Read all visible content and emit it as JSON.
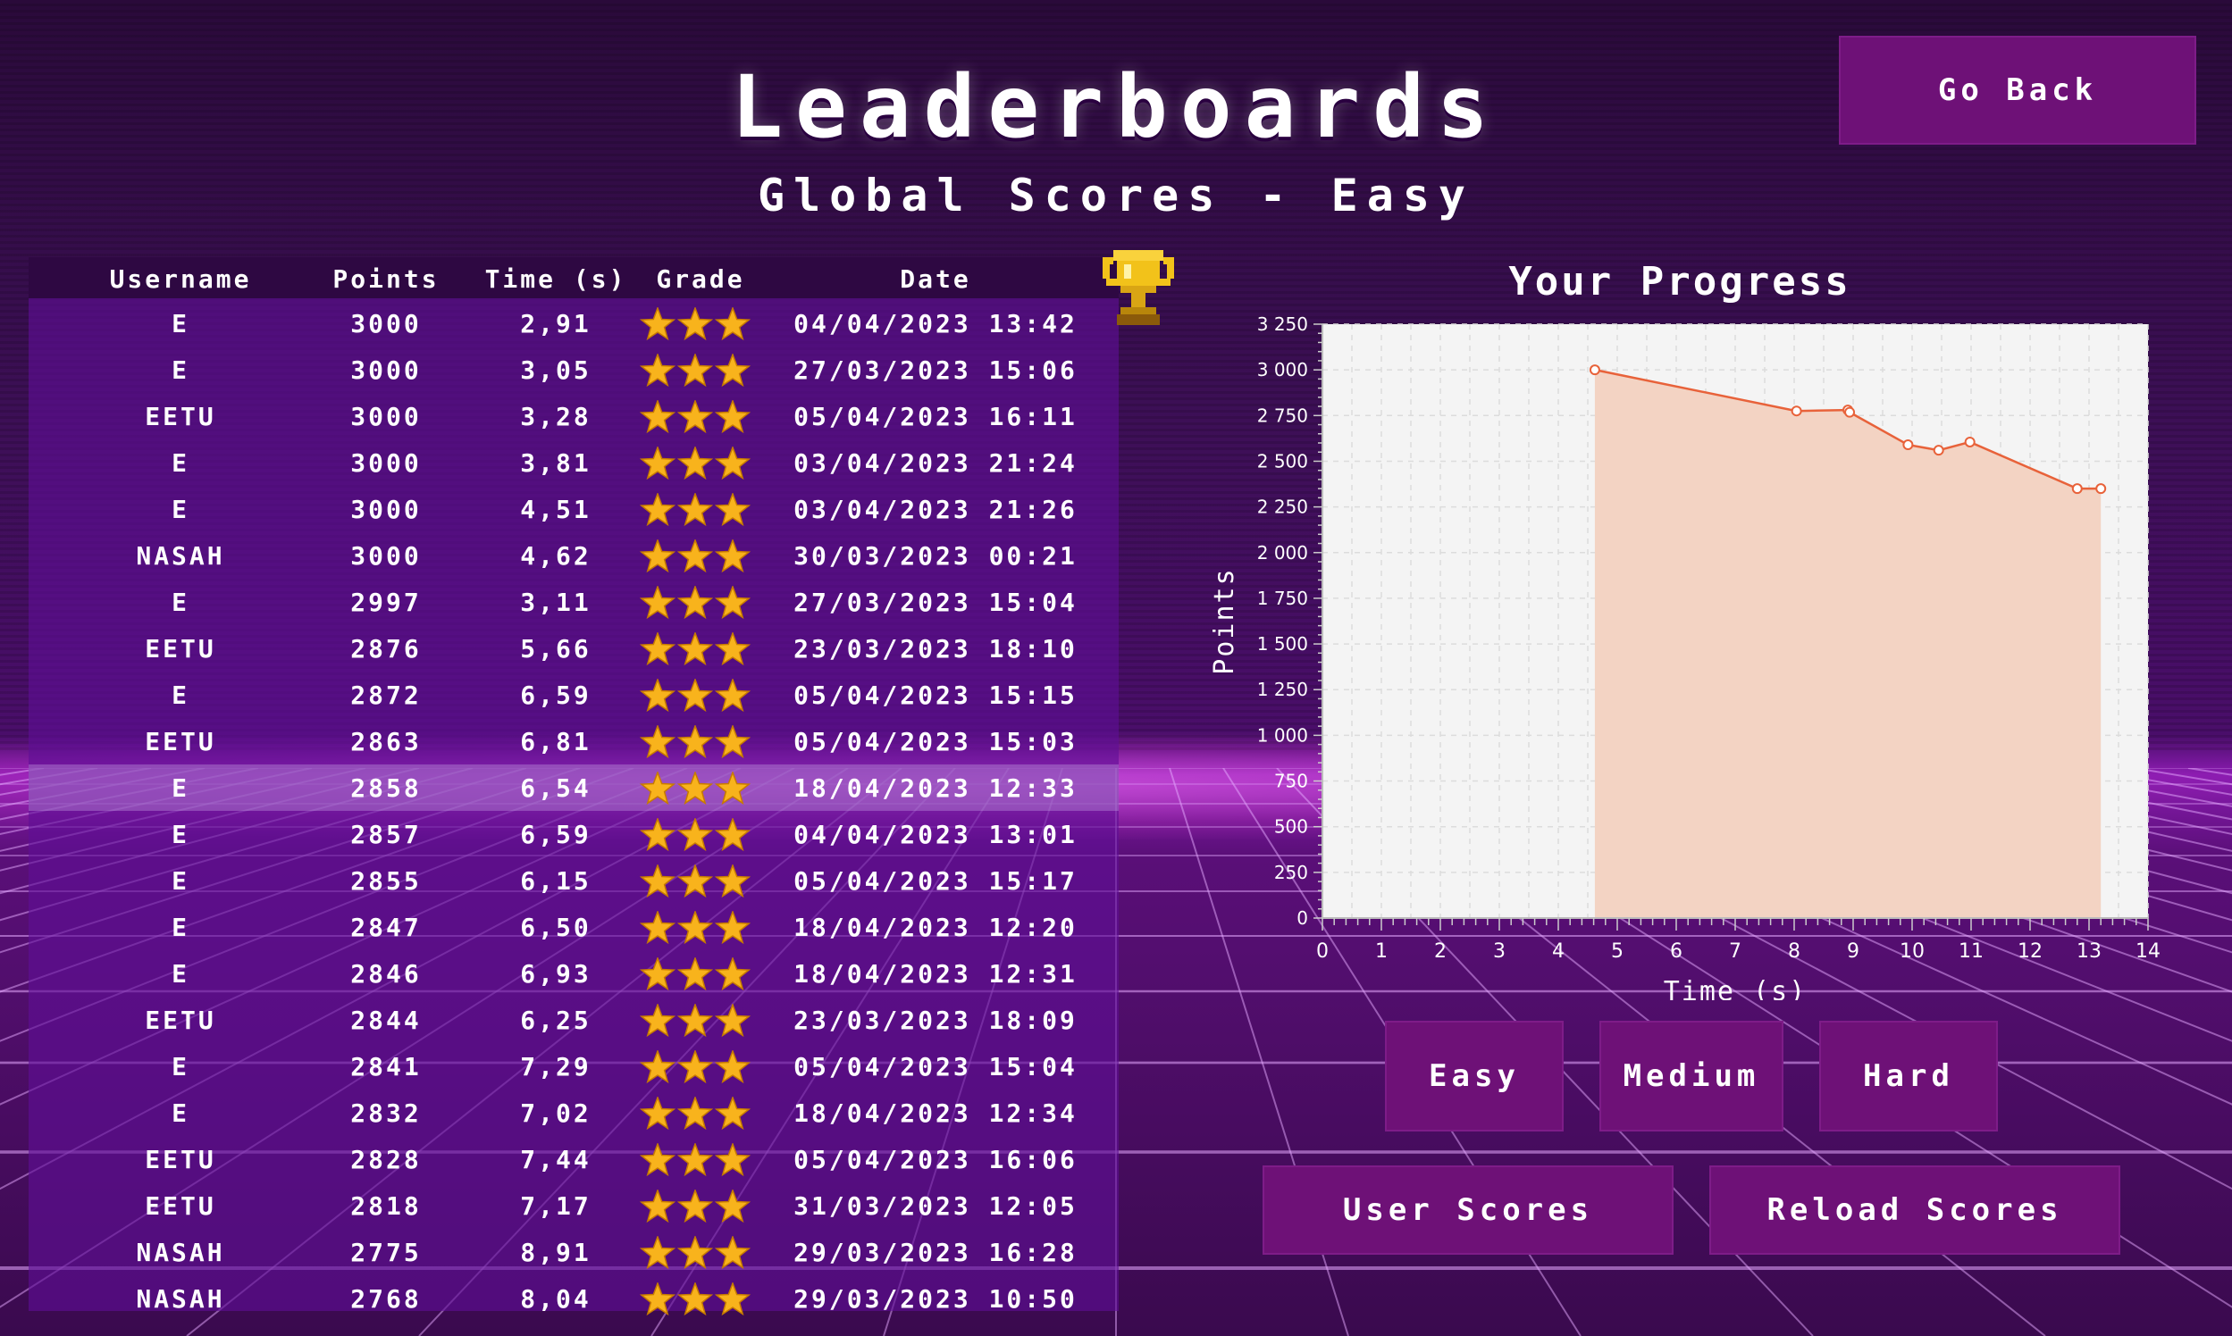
{
  "title": "Leaderboards",
  "subtitle": "Global Scores - Easy",
  "go_back_label": "Go Back",
  "table": {
    "headers": [
      "Username",
      "Points",
      "Time (s)",
      "Grade",
      "Date"
    ],
    "rows": [
      {
        "user": "E",
        "points": "3000",
        "time": "2,91",
        "stars": 3,
        "date": "04/04/2023 13:42"
      },
      {
        "user": "E",
        "points": "3000",
        "time": "3,05",
        "stars": 3,
        "date": "27/03/2023 15:06"
      },
      {
        "user": "EETU",
        "points": "3000",
        "time": "3,28",
        "stars": 3,
        "date": "05/04/2023 16:11"
      },
      {
        "user": "E",
        "points": "3000",
        "time": "3,81",
        "stars": 3,
        "date": "03/04/2023 21:24"
      },
      {
        "user": "E",
        "points": "3000",
        "time": "4,51",
        "stars": 3,
        "date": "03/04/2023 21:26"
      },
      {
        "user": "NASAH",
        "points": "3000",
        "time": "4,62",
        "stars": 3,
        "date": "30/03/2023 00:21"
      },
      {
        "user": "E",
        "points": "2997",
        "time": "3,11",
        "stars": 3,
        "date": "27/03/2023 15:04"
      },
      {
        "user": "EETU",
        "points": "2876",
        "time": "5,66",
        "stars": 3,
        "date": "23/03/2023 18:10"
      },
      {
        "user": "E",
        "points": "2872",
        "time": "6,59",
        "stars": 3,
        "date": "05/04/2023 15:15"
      },
      {
        "user": "EETU",
        "points": "2863",
        "time": "6,81",
        "stars": 3,
        "date": "05/04/2023 15:03"
      },
      {
        "user": "E",
        "points": "2858",
        "time": "6,54",
        "stars": 3,
        "date": "18/04/2023 12:33"
      },
      {
        "user": "E",
        "points": "2857",
        "time": "6,59",
        "stars": 3,
        "date": "04/04/2023 13:01"
      },
      {
        "user": "E",
        "points": "2855",
        "time": "6,15",
        "stars": 3,
        "date": "05/04/2023 15:17"
      },
      {
        "user": "E",
        "points": "2847",
        "time": "6,50",
        "stars": 3,
        "date": "18/04/2023 12:20"
      },
      {
        "user": "E",
        "points": "2846",
        "time": "6,93",
        "stars": 3,
        "date": "18/04/2023 12:31"
      },
      {
        "user": "EETU",
        "points": "2844",
        "time": "6,25",
        "stars": 3,
        "date": "23/03/2023 18:09"
      },
      {
        "user": "E",
        "points": "2841",
        "time": "7,29",
        "stars": 3,
        "date": "05/04/2023 15:04"
      },
      {
        "user": "E",
        "points": "2832",
        "time": "7,02",
        "stars": 3,
        "date": "18/04/2023 12:34"
      },
      {
        "user": "EETU",
        "points": "2828",
        "time": "7,44",
        "stars": 3,
        "date": "05/04/2023 16:06"
      },
      {
        "user": "EETU",
        "points": "2818",
        "time": "7,17",
        "stars": 3,
        "date": "31/03/2023 12:05"
      },
      {
        "user": "NASAH",
        "points": "2775",
        "time": "8,91",
        "stars": 3,
        "date": "29/03/2023 16:28"
      },
      {
        "user": "NASAH",
        "points": "2768",
        "time": "8,04",
        "stars": 3,
        "date": "29/03/2023 10:50"
      }
    ]
  },
  "chart_data": {
    "type": "area",
    "title": "Your Progress",
    "xlabel": "Time (s)",
    "ylabel": "Points",
    "xlim": [
      0,
      14
    ],
    "ylim": [
      0,
      3250
    ],
    "x_ticks": [
      0,
      1,
      2,
      3,
      4,
      5,
      6,
      7,
      8,
      9,
      10,
      11,
      12,
      13,
      14
    ],
    "y_ticks": [
      0,
      250,
      500,
      750,
      1000,
      1250,
      1500,
      1750,
      2000,
      2250,
      2500,
      2750,
      3000,
      3250
    ],
    "y_tick_labels": [
      "0",
      "250",
      "500",
      "750",
      "1 000",
      "1 250",
      "1 500",
      "1 750",
      "2 000",
      "2 250",
      "2 500",
      "2 750",
      "3 000",
      "3 250"
    ],
    "grid": true,
    "series": [
      {
        "x": [
          4.62,
          8.04,
          8.91,
          8.94,
          9.93,
          10.45,
          10.98,
          12.8,
          13.2
        ],
        "y": [
          3000,
          2775,
          2780,
          2768,
          2590,
          2560,
          2605,
          2350,
          2350
        ]
      }
    ]
  },
  "difficulty_buttons": [
    "Easy",
    "Medium",
    "Hard"
  ],
  "user_scores_label": "User Scores",
  "reload_scores_label": "Reload Scores",
  "colors": {
    "button": "#6e1177",
    "line": "#e8623a",
    "fill": "#f3d3c3",
    "plot_bg": "#f4f4f4",
    "star": "#f8b31c",
    "header_bg": "#2e0842"
  },
  "icons": {
    "trophy": "trophy-icon",
    "star": "star-icon"
  }
}
